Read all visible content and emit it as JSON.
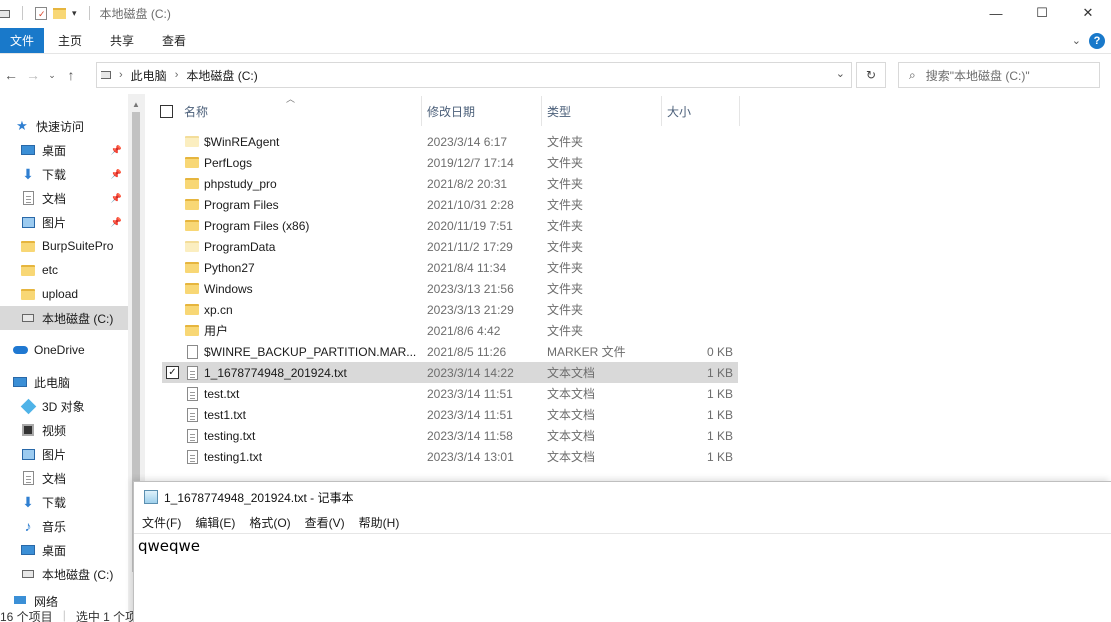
{
  "title_bar": {
    "path": "本地磁盘 (C:)",
    "controls": {
      "minimize": "—",
      "maximize": "☐",
      "close": "✕"
    }
  },
  "ribbon": {
    "tabs": [
      "文件",
      "主页",
      "共享",
      "查看"
    ],
    "help": "?",
    "collapse_icon": "chevron-down"
  },
  "address": {
    "crumbs": [
      "此电脑",
      "本地磁盘 (C:)"
    ],
    "search_placeholder": "搜索\"本地磁盘 (C:)\""
  },
  "nav": {
    "quick_access": "快速访问",
    "items": [
      {
        "label": "桌面",
        "icon": "desktop-icon",
        "pinned": true
      },
      {
        "label": "下载",
        "icon": "download-icon",
        "pinned": true
      },
      {
        "label": "文档",
        "icon": "document-icon",
        "pinned": true
      },
      {
        "label": "图片",
        "icon": "picture-icon",
        "pinned": true
      },
      {
        "label": "BurpSuitePro",
        "icon": "folder-icon"
      },
      {
        "label": "etc",
        "icon": "folder-icon"
      },
      {
        "label": "upload",
        "icon": "folder-icon"
      },
      {
        "label": "本地磁盘 (C:)",
        "icon": "drive-icon",
        "selected": true
      }
    ],
    "onedrive": "OneDrive",
    "this_pc": "此电脑",
    "pc_items": [
      {
        "label": "3D 对象",
        "icon": "3d-objects-icon"
      },
      {
        "label": "视频",
        "icon": "video-icon"
      },
      {
        "label": "图片",
        "icon": "picture-icon"
      },
      {
        "label": "文档",
        "icon": "document-icon"
      },
      {
        "label": "下载",
        "icon": "download-icon"
      },
      {
        "label": "音乐",
        "icon": "music-icon"
      },
      {
        "label": "桌面",
        "icon": "desktop-icon"
      },
      {
        "label": "本地磁盘 (C:)",
        "icon": "drive-icon"
      }
    ],
    "network": "网络"
  },
  "columns": {
    "name": "名称",
    "date": "修改日期",
    "type": "类型",
    "size": "大小"
  },
  "files": [
    {
      "name": "$WinREAgent",
      "date": "2023/3/14 6:17",
      "type": "文件夹",
      "size": "",
      "icon": "folder-light"
    },
    {
      "name": "PerfLogs",
      "date": "2019/12/7 17:14",
      "type": "文件夹",
      "size": "",
      "icon": "folder"
    },
    {
      "name": "phpstudy_pro",
      "date": "2021/8/2 20:31",
      "type": "文件夹",
      "size": "",
      "icon": "folder"
    },
    {
      "name": "Program Files",
      "date": "2021/10/31 2:28",
      "type": "文件夹",
      "size": "",
      "icon": "folder"
    },
    {
      "name": "Program Files (x86)",
      "date": "2020/11/19 7:51",
      "type": "文件夹",
      "size": "",
      "icon": "folder"
    },
    {
      "name": "ProgramData",
      "date": "2021/11/2 17:29",
      "type": "文件夹",
      "size": "",
      "icon": "folder-light"
    },
    {
      "name": "Python27",
      "date": "2021/8/4 11:34",
      "type": "文件夹",
      "size": "",
      "icon": "folder"
    },
    {
      "name": "Windows",
      "date": "2023/3/13 21:56",
      "type": "文件夹",
      "size": "",
      "icon": "folder"
    },
    {
      "name": "xp.cn",
      "date": "2023/3/13 21:29",
      "type": "文件夹",
      "size": "",
      "icon": "folder"
    },
    {
      "name": "用户",
      "date": "2021/8/6 4:42",
      "type": "文件夹",
      "size": "",
      "icon": "folder"
    },
    {
      "name": "$WINRE_BACKUP_PARTITION.MAR...",
      "date": "2021/8/5 11:26",
      "type": "MARKER 文件",
      "size": "0 KB",
      "icon": "blank"
    },
    {
      "name": "1_1678774948_201924.txt",
      "date": "2023/3/14 14:22",
      "type": "文本文档",
      "size": "1 KB",
      "icon": "text",
      "selected": true
    },
    {
      "name": "test.txt",
      "date": "2023/3/14 11:51",
      "type": "文本文档",
      "size": "1 KB",
      "icon": "text"
    },
    {
      "name": "test1.txt",
      "date": "2023/3/14 11:51",
      "type": "文本文档",
      "size": "1 KB",
      "icon": "text"
    },
    {
      "name": "testing.txt",
      "date": "2023/3/14 11:58",
      "type": "文本文档",
      "size": "1 KB",
      "icon": "text"
    },
    {
      "name": "testing1.txt",
      "date": "2023/3/14 13:01",
      "type": "文本文档",
      "size": "1 KB",
      "icon": "text"
    }
  ],
  "status": {
    "count": "16 个项目",
    "selected": "选中 1 个项"
  },
  "notepad": {
    "title": "1_1678774948_201924.txt - 记事本",
    "menu": [
      "文件(F)",
      "编辑(E)",
      "格式(O)",
      "查看(V)",
      "帮助(H)"
    ],
    "content": "qweqwe"
  }
}
